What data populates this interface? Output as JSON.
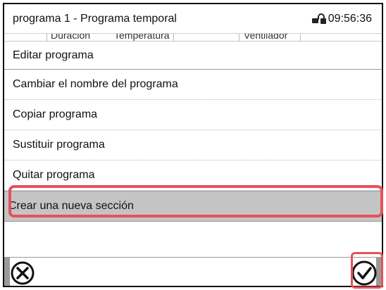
{
  "header": {
    "title": "programa 1 - Programa temporal",
    "time": "09:56:36",
    "lock_icon": "lock-icon"
  },
  "background_table": {
    "columns": [
      "Duración",
      "Temperatura",
      "Ventilador"
    ]
  },
  "popup": {
    "title": "Editar programa",
    "items": [
      {
        "label": "Cambiar el nombre del programa"
      },
      {
        "label": "Copiar programa"
      },
      {
        "label": "Sustituir programa"
      },
      {
        "label": "Quitar programa"
      },
      {
        "label": "Crear una nueva sección",
        "selected": true
      }
    ]
  },
  "footer": {
    "cancel_icon": "close-circle-icon",
    "confirm_icon": "check-circle-icon"
  },
  "colors": {
    "highlight": "#e8505b",
    "selected_row": "#c4c4c4"
  }
}
